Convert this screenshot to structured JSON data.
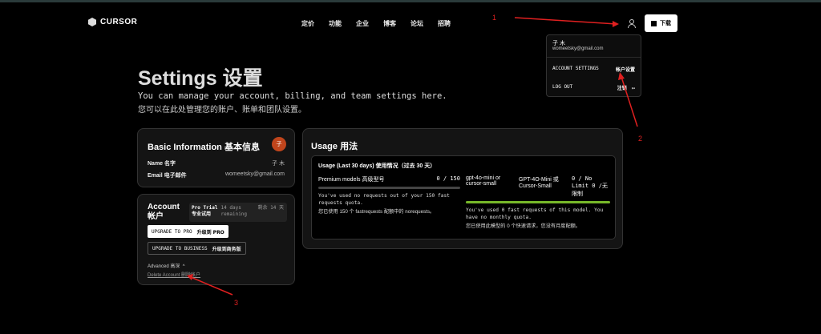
{
  "nav": {
    "logo": "CURSOR",
    "links": [
      "定价",
      "功能",
      "企业",
      "博客",
      "论坛",
      "招聘"
    ],
    "download": "下载"
  },
  "dropdown": {
    "name": "子 木",
    "email": "womeetsky@gmail.com",
    "settings_en": "ACCOUNT SETTINGS",
    "settings_cn": "帐户设置",
    "logout_en": "LOG OUT",
    "logout_cn": "注销"
  },
  "page": {
    "title": "Settings 设置",
    "subtitle_en": "You can manage your account, billing, and team settings here.",
    "subtitle_cn": "您可以在此处管理您的账户、账单和团队设置。"
  },
  "basic": {
    "title": "Basic Information 基本信息",
    "avatar": "子",
    "name_label": "Name 名字",
    "name_value": "子 木",
    "email_label": "Email 电子邮件",
    "email_value": "womeetsky@gmail.com"
  },
  "account": {
    "title_en": "Account",
    "title_cn": "帐户",
    "trial_badge_en": "Pro Trial",
    "trial_badge_cn": "专业试用",
    "remaining_en": "14 days remaining",
    "remaining_cn": "剩余 14 天",
    "upgrade_pro_en": "UPGRADE TO PRO",
    "upgrade_pro_cn": "升级到 PRO",
    "upgrade_biz_en": "UPGRADE TO BUSINESS",
    "upgrade_biz_cn": "升级到商务版",
    "advanced": "Advanced 高深",
    "delete": "Delete Account 删除帐户"
  },
  "usage": {
    "title": "Usage 用法",
    "period": "Usage (Last 30 days) 使用情况（过去 30 天）",
    "premium_label": "Premium models 高级型号",
    "premium_count": "0 / 150",
    "premium_fraction": 0,
    "premium_note_en": "You've used no requests out of your 150 fast requests quota.",
    "premium_note_cn": "您已使用 150 个 fastrequests 配额中的 norequests。",
    "mini_label_en": "gpt-4o-mini or cursor-small",
    "mini_label_cn": "GPT-4O-Mini 或 Cursor-Small",
    "mini_count": "0 / No Limit 0 /无限制",
    "mini_fraction": 1,
    "mini_note_en": "You've used 0 fast requests of this model. You have no monthly quota.",
    "mini_note_cn": "您已使用此模型的 0 个快速请求，您没有月度配额。"
  },
  "annotations": [
    "1",
    "2",
    "3"
  ],
  "colors": {
    "background": "#000000",
    "card": "#141414",
    "avatar": "#c0451c",
    "progress_green": "#77b82a",
    "annotation_red": "#e02020"
  }
}
